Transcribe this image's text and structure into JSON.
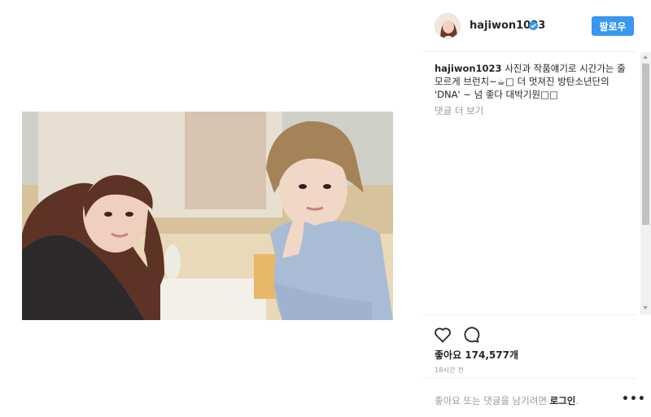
{
  "post": {
    "username": "hajiwon1023",
    "follow_label": "팔로우",
    "caption_user": "hajiwon1023",
    "caption_text": "사진과 작품얘기로 시간가는 줄 모르게 브런치~☕□ 더 멋져진 방탄소년단의 'DNA' ~ 넘 좋다 대박기원□□",
    "view_comments": "댓글 더 보기",
    "likes_label": "좋아요 174,577개",
    "timestamp": "18시간 전",
    "login_prefix": "좋아요 또는 댓글을 남기려면",
    "login_link": "로그인",
    "login_suffix": ".",
    "more_options": "•••"
  },
  "icons": {
    "verified": "verified-badge-icon",
    "like": "heart-icon",
    "comment": "comment-bubble-icon",
    "scroll_up": "scroll-up-arrow-icon",
    "scroll_down": "scroll-down-arrow-icon"
  },
  "colors": {
    "accent": "#3897f0",
    "text": "#262626",
    "muted": "#999999",
    "divider": "#efefef"
  }
}
